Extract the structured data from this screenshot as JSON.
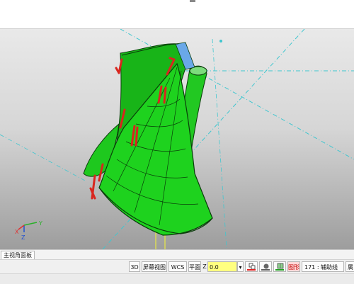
{
  "window": {
    "title": ""
  },
  "viewport": {
    "background_top": "#e9e9e9",
    "background_bottom": "#9d9d9d",
    "model_color": "#1ec81e",
    "model_edge_color": "#0a3d0a",
    "arrow_color": "#d8261e",
    "guide_line_color": "#3fc6cf",
    "construction_line_color": "#e8e845",
    "axis_labels": {
      "x": "X",
      "y": "Y",
      "z": "Z"
    },
    "axis_colors": {
      "x": "#e03030",
      "y": "#2ab02a",
      "z": "#2050d0"
    }
  },
  "tabs": [
    {
      "label": "主视角面板",
      "active": true
    }
  ],
  "statusbar": {
    "mode_3d": "3D",
    "screen_view": "屏幕视图",
    "wcs": "WCS",
    "plane": "平面",
    "z_label": "Z",
    "z_value": "0.0",
    "z_value_bg": "#ffff80",
    "dropdown_arrow": "▾",
    "layer_button": "图形",
    "layer_value": "171 : 辅助线",
    "right_truncated": "属",
    "color_chips": [
      {
        "name": "line-color",
        "underline": "#e02020"
      },
      {
        "name": "solid-color",
        "underline": "#606060"
      },
      {
        "name": "surface-color",
        "underline": "#20a020"
      }
    ]
  }
}
